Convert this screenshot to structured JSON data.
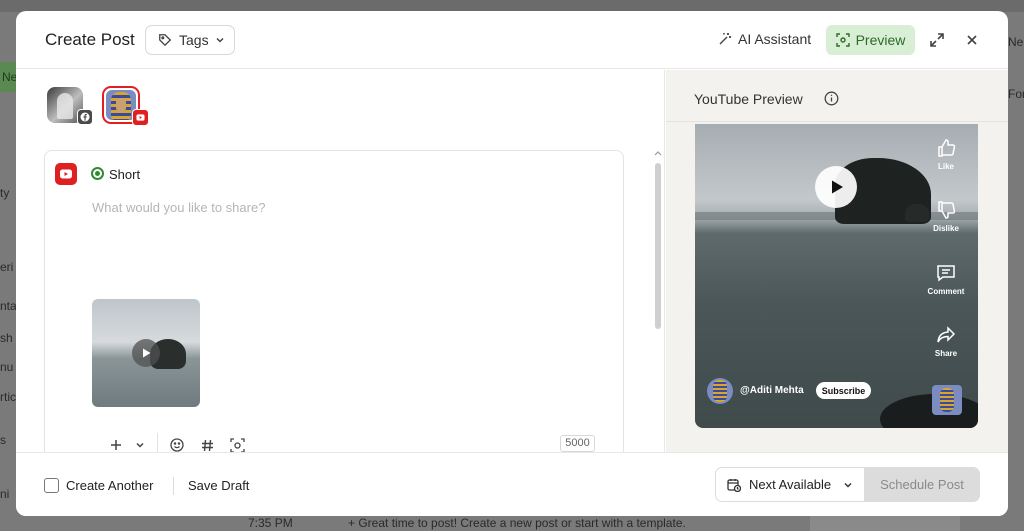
{
  "background": {
    "left_fragments": [
      "Ne",
      "ty",
      "eri",
      "nta",
      "sh",
      "nu",
      "rtic",
      "s",
      "ni"
    ],
    "right_fragments": [
      "Ne",
      "For"
    ],
    "bottom_time": "7:35 PM",
    "bottom_prompt": "+ Great time to post! Create a new post or start with a template."
  },
  "header": {
    "title": "Create Post",
    "tags_label": "Tags",
    "ai_label": "AI Assistant",
    "preview_label": "Preview"
  },
  "editor": {
    "post_type": "Short",
    "placeholder": "What would you like to share?",
    "char_count": "5000"
  },
  "footer": {
    "create_another": "Create Another",
    "save_draft": "Save Draft",
    "next_available": "Next Available",
    "schedule": "Schedule Post"
  },
  "preview": {
    "title": "YouTube Preview",
    "actions": {
      "like": "Like",
      "dislike": "Dislike",
      "comment": "Comment",
      "share": "Share"
    },
    "channel": "@Aditi Mehta",
    "subscribe": "Subscribe"
  },
  "colors": {
    "accent_green": "#2e8b2e",
    "preview_bg": "#d9efd5",
    "youtube_red": "#e02020"
  }
}
